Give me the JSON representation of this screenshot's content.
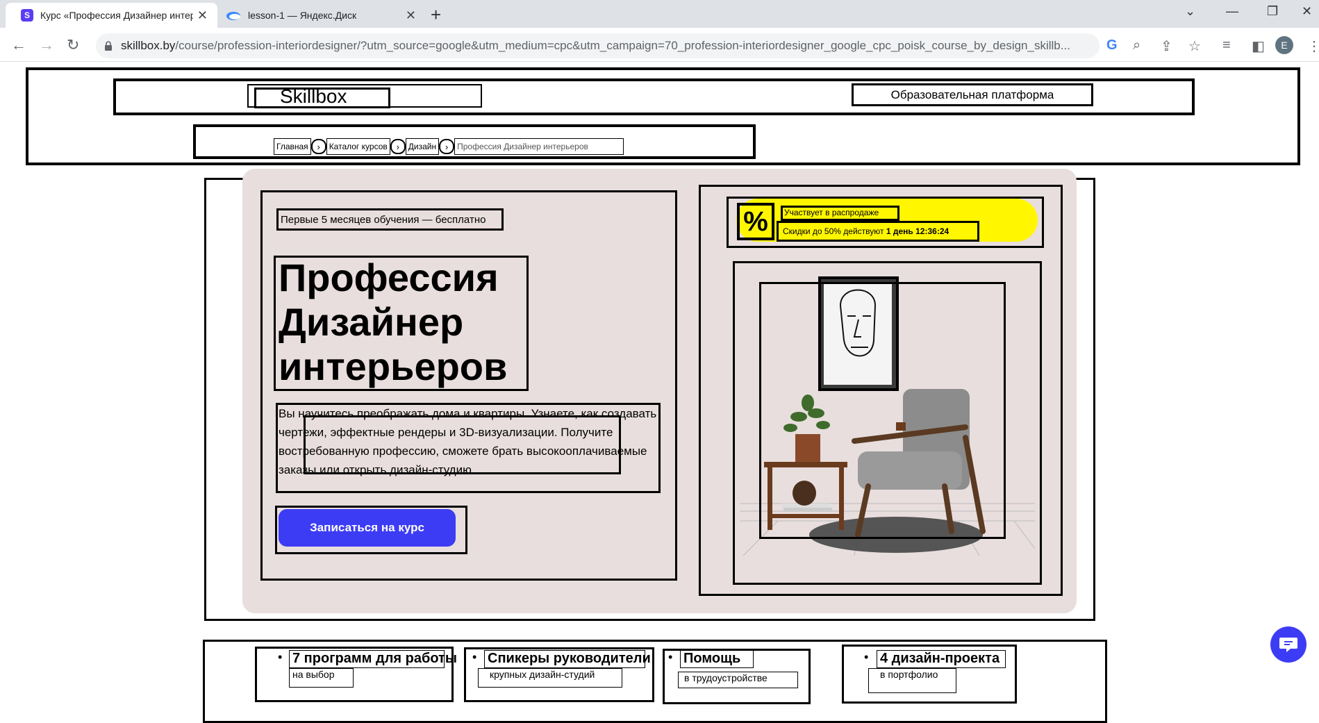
{
  "browser": {
    "tabs": [
      {
        "title": "Курс «Профессия Дизайнер интерьеров»"
      },
      {
        "title": "lesson-1 — Яндекс.Диск"
      }
    ],
    "favicon_letter": "S",
    "new_tab": "+",
    "window_controls": {
      "dropdown": "⌄",
      "minimize": "—",
      "restore": "❐",
      "close": "✕"
    },
    "url_host": "skillbox.by",
    "url_rest": "/course/profession-interiordesigner/?utm_source=google&utm_medium=cpc&utm_campaign=70_profession-interiordesigner_google_cpc_poisk_course_by_design_skillb...",
    "avatar_letter": "E"
  },
  "header": {
    "logo": "Skillbox",
    "tagline": "Образовательная платформа"
  },
  "breadcrumb": [
    {
      "label": "Главная"
    },
    {
      "label": "Каталог курсов"
    },
    {
      "label": "Дизайн"
    },
    {
      "label": "Профессия Дизайнер интерьеров"
    }
  ],
  "hero": {
    "promo": "Первые 5 месяцев обучения — бесплатно",
    "title_line1": "Профессия",
    "title_line2": "Дизайнер",
    "title_line3": "интерьеров",
    "description": "Вы научитесь преображать дома и квартиры. Узнаете, как создавать чертежи, эффектные рендеры и 3D-визуализации. Получите востребованную профессию, сможете брать высокооплачиваемые заказы или открыть дизайн-студию.",
    "cta": "Записаться на курс"
  },
  "sale": {
    "icon_glyph": "%",
    "label": "Участвует в распродаже",
    "discount_text": "Скидки до 50% действуют",
    "days": "1 день",
    "timer": "12:36:24"
  },
  "features": [
    {
      "title": "7 программ для работы",
      "sub": "на выбор"
    },
    {
      "title": "Спикеры руководители",
      "sub": "крупных дизайн-студий"
    },
    {
      "title": "Помощь",
      "sub": "в трудоустройстве"
    },
    {
      "title": "4 дизайн-проекта",
      "sub": "в портфолио"
    }
  ],
  "colors": {
    "accent": "#3d3cf5",
    "hero_bg": "#e8dedd",
    "sale_yellow": "#fff600"
  }
}
